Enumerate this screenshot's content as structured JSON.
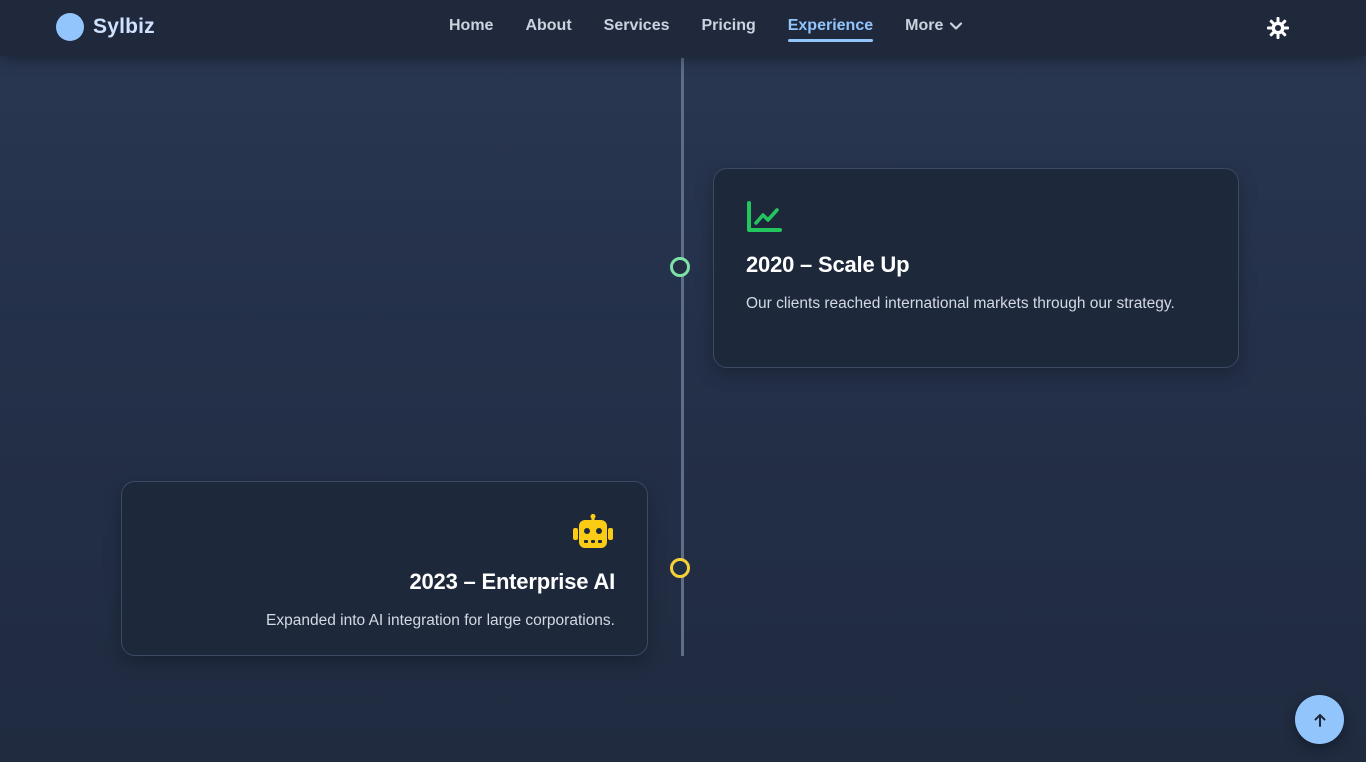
{
  "brand": {
    "name": "Sylbiz",
    "logo_color": "#93c5fd"
  },
  "nav": {
    "items": [
      {
        "label": "Home"
      },
      {
        "label": "About"
      },
      {
        "label": "Services"
      },
      {
        "label": "Pricing"
      },
      {
        "label": "Experience",
        "active": true
      },
      {
        "label": "More",
        "has_dropdown": true,
        "icon": "chevron-down-icon"
      }
    ],
    "theme_toggle_icon": "sun-icon"
  },
  "timeline": [
    {
      "title": "2020 – Scale Up",
      "description": "Our clients reached international markets through our strategy.",
      "icon": "chart-line-icon",
      "accent": "#22c55e",
      "side": "right"
    },
    {
      "title": "2023 – Enterprise AI",
      "description": "Expanded into AI integration for large corporations.",
      "icon": "robot-icon",
      "accent": "#facc15",
      "side": "left"
    }
  ],
  "scroll_top": {
    "icon": "arrow-up-icon"
  },
  "colors": {
    "accent": "#93c5fd",
    "background": "#243049",
    "card": "#1e283b"
  }
}
